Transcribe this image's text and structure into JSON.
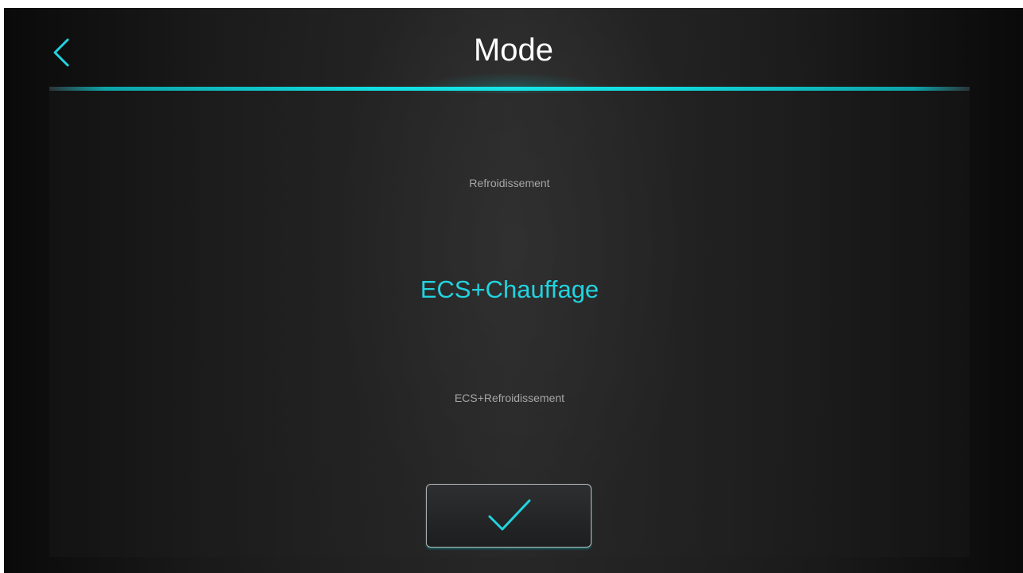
{
  "header": {
    "title": "Mode",
    "back_icon": "chevron-left-icon"
  },
  "mode_picker": {
    "options": [
      {
        "label": "Refroidissement",
        "selected": false
      },
      {
        "label": "ECS+Chauffage",
        "selected": true
      },
      {
        "label": "ECS+Refroidissement",
        "selected": false
      }
    ]
  },
  "confirm": {
    "icon": "checkmark-icon"
  },
  "colors": {
    "accent": "#22d3df",
    "background": "#1e1e1e",
    "text": "#ffffff",
    "muted_text": "#a6a6a6"
  }
}
